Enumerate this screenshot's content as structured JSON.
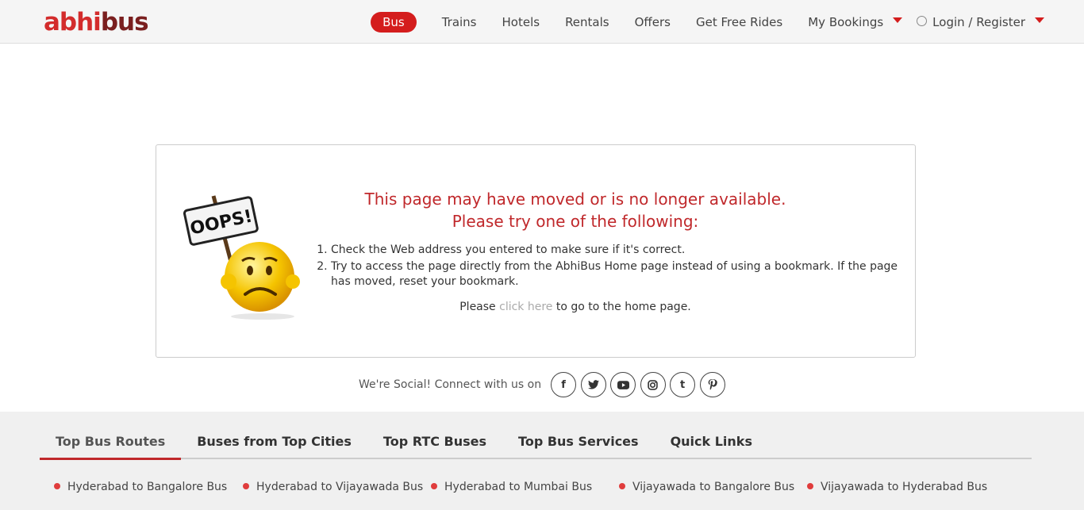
{
  "header": {
    "logo_part1": "abhi",
    "logo_part2": "bus",
    "nav": [
      "Bus",
      "Trains",
      "Hotels",
      "Rentals",
      "Offers",
      "Get Free Rides",
      "My Bookings",
      "Login / Register"
    ]
  },
  "error": {
    "title_line1": "This page may have moved or is no longer available.",
    "title_line2": "Please try one of the following:",
    "items": [
      "Check the Web address you entered to make sure if it's correct.",
      "Try to access the page directly from the AbhiBus Home page instead of using a bookmark. If the page has moved, reset your bookmark."
    ],
    "home_prefix": "Please",
    "home_link": "click here",
    "home_suffix": "to go to the home page.",
    "oops_sign": "OOPS!"
  },
  "social": {
    "label": "We're Social! Connect with us on",
    "icons": [
      "facebook-icon",
      "twitter-icon",
      "youtube-icon",
      "instagram-icon",
      "tumblr-icon",
      "pinterest-icon"
    ]
  },
  "footer": {
    "tabs": [
      "Top Bus Routes",
      "Buses from Top Cities",
      "Top RTC Buses",
      "Top Bus Services",
      "Quick Links"
    ],
    "routes": [
      "Hyderabad to Bangalore Bus",
      "Hyderabad to Vijayawada Bus",
      "Hyderabad to Mumbai Bus",
      "Vijayawada to Bangalore Bus",
      "Vijayawada to Hyderabad Bus"
    ]
  },
  "colors": {
    "brand_red": "#d41d1d",
    "title_red": "#c0282b"
  }
}
